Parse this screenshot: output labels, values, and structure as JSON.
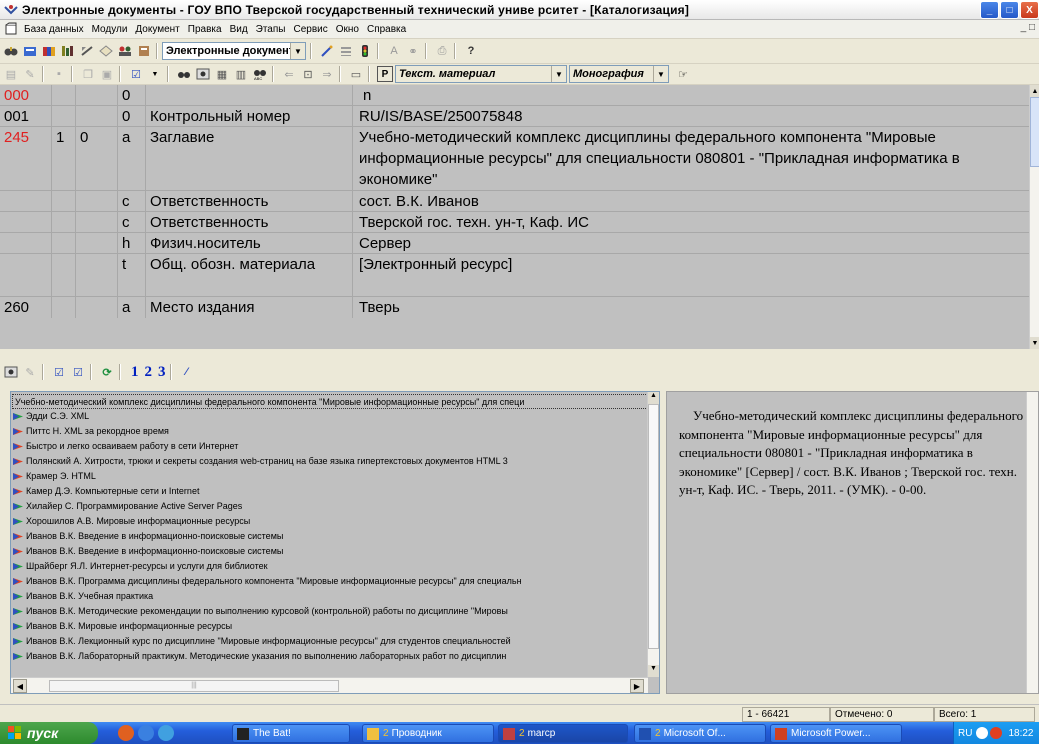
{
  "window": {
    "title": "Электронные документы - ГОУ ВПО Тверской государственный технический униве рситет - [Каталогизация]"
  },
  "menu": [
    "База данных",
    "Модули",
    "Документ",
    "Правка",
    "Вид",
    "Этапы",
    "Сервис",
    "Окно",
    "Справка"
  ],
  "toolbar": {
    "db_combo": "Электронные документы",
    "material_combo": "Текст. материал",
    "type_combo": "Монография"
  },
  "record": [
    {
      "tag": "000",
      "ind1": "",
      "ind2": "",
      "sf": "0",
      "name": "",
      "value": "n",
      "red": true
    },
    {
      "tag": "001",
      "ind1": "",
      "ind2": "",
      "sf": "0",
      "name": "Контрольный номер",
      "value": "RU/IS/BASE/250075848",
      "red": false
    },
    {
      "tag": "245",
      "ind1": "1",
      "ind2": "0",
      "sf": "a",
      "name": "Заглавие",
      "value": "Учебно-методический комплекс дисциплины федерального компонента \"Мировые информационные ресурсы\" для специальности 080801 - \"Прикладная информатика в экономике\"",
      "red": true
    },
    {
      "tag": "",
      "ind1": "",
      "ind2": "",
      "sf": "c",
      "name": "Ответственность",
      "value": "сост. В.К. Иванов",
      "red": false
    },
    {
      "tag": "",
      "ind1": "",
      "ind2": "",
      "sf": "c",
      "name": "Ответственность",
      "value": "Тверской гос. техн. ун-т, Каф. ИС",
      "red": false
    },
    {
      "tag": "",
      "ind1": "",
      "ind2": "",
      "sf": "h",
      "name": "Физич.носитель",
      "value": "Сервер",
      "red": false
    },
    {
      "tag": "",
      "ind1": "",
      "ind2": "",
      "sf": "t",
      "name": "Общ. обозн. материала",
      "value": "[Электронный ресурс]",
      "red": false
    },
    {
      "tag": "260",
      "ind1": "",
      "ind2": "",
      "sf": "a",
      "name": "Место издания",
      "value": "Тверь",
      "red": false
    }
  ],
  "lower_toolbar": {
    "n1": "1",
    "n2": "2",
    "n3": "3"
  },
  "list": [
    {
      "text": "Учебно-методический комплекс дисциплины федерального компонента \"Мировые информационные ресурсы\" для специ",
      "icon": "none"
    },
    {
      "text": "Эдди С.Э. XML",
      "icon": "green"
    },
    {
      "text": "Питтс Н. XML за рекордное время",
      "icon": "red"
    },
    {
      "text": "Быстро и легко осваиваем работу в сети Интернет",
      "icon": "red"
    },
    {
      "text": "Полянский А. Хитрости, трюки и секреты создания web-страниц на базе языка гипертекстовых документов HTML 3",
      "icon": "red"
    },
    {
      "text": "Крамер Э. HTML",
      "icon": "red"
    },
    {
      "text": "Камер Д.Э. Компьютерные сети и Internet",
      "icon": "red"
    },
    {
      "text": "Хилайер С. Программирование Active Server Pages",
      "icon": "green"
    },
    {
      "text": "Хорошилов А.В. Мировые информационные ресурсы",
      "icon": "green"
    },
    {
      "text": "Иванов В.К. Введение в информационно-поисковые системы",
      "icon": "red"
    },
    {
      "text": "Иванов В.К. Введение в информационно-поисковые системы",
      "icon": "red"
    },
    {
      "text": "Шрайберг Я.Л. Интернет-ресурсы и услуги для библиотек",
      "icon": "green"
    },
    {
      "text": "Иванов В.К. Программа дисциплины федерального компонента \"Мировые информационные ресурсы\" для специальн",
      "icon": "red"
    },
    {
      "text": "Иванов В.К. Учебная практика",
      "icon": "green"
    },
    {
      "text": "Иванов В.К. Методические рекомендации по выполнению курсовой (контрольной) работы по дисциплине \"Мировы",
      "icon": "green"
    },
    {
      "text": "Иванов В.К. Мировые информационные ресурсы",
      "icon": "green"
    },
    {
      "text": "Иванов В.К. Лекционный курс по дисциплине \"Мировые информационные ресурсы\" для студентов специальностей",
      "icon": "green"
    },
    {
      "text": "Иванов В.К. Лабораторный практикум. Методические указания по выполнению лабораторных работ по дисциплин",
      "icon": "green"
    }
  ],
  "preview_text": "Учебно-методический комплекс дисциплины федерального компонента \"Мировые информационные ресурсы\" для специальности 080801 - \"Прикладная информатика в экономике\" [Сервер] / сост. В.К. Иванов ; Тверской гос. техн. ун-т, Каф. ИС. - Тверь, 2011. - (УМК). - 0-00.",
  "status": {
    "range": "1 - 66421",
    "marked": "Отмечено: 0",
    "total": "Всего: 1"
  },
  "taskbar": {
    "start": "пуск",
    "tasks": [
      {
        "label": "The Bat!",
        "num": ""
      },
      {
        "label": "Проводник",
        "num": "2"
      },
      {
        "label": "marcp",
        "num": "2"
      },
      {
        "label": "Microsoft Of...",
        "num": "2"
      },
      {
        "label": "Microsoft Power...",
        "num": ""
      }
    ],
    "lang": "RU",
    "clock": "18:22"
  }
}
